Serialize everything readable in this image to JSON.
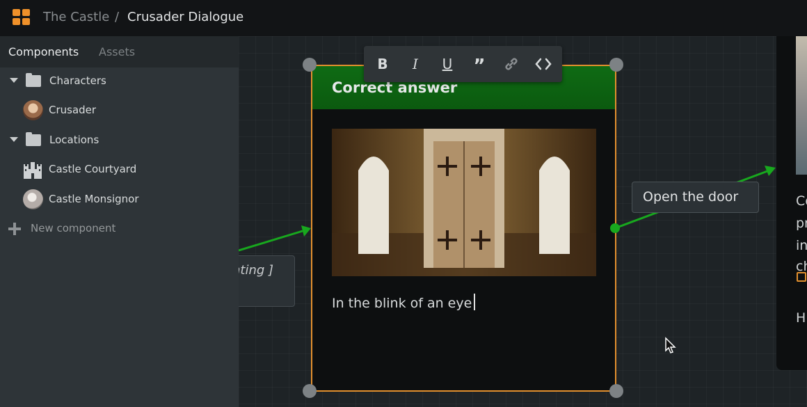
{
  "breadcrumb": {
    "project": "The Castle",
    "separator": "/",
    "current": "Crusader Dialogue"
  },
  "sidebar": {
    "tabs": [
      "Components",
      "Assets"
    ],
    "tree": [
      {
        "label": "Characters",
        "icon": "folder-icon"
      },
      {
        "label": "Crusader",
        "icon": "crusader-avatar"
      },
      {
        "label": "Locations",
        "icon": "folder-icon"
      },
      {
        "label": "Castle Courtyard",
        "icon": "castle-icon"
      },
      {
        "label": "Castle Monsignor",
        "icon": "monsignor-avatar"
      }
    ],
    "new_component": "New component"
  },
  "canvas": {
    "left_node_text": "nting ]",
    "node": {
      "title": "Correct answer",
      "text": "In the blink of an eye"
    },
    "toolbar": [
      "bold-icon",
      "italic-icon",
      "underline-icon",
      "quote-icon",
      "link-icon",
      "code-icon"
    ],
    "choice_label": "Open the door",
    "right_panel_fragments": [
      "Co",
      "pr",
      "in",
      "ch",
      "H"
    ]
  },
  "colors": {
    "accent": "#e3902e",
    "header_green": "#0f6b14",
    "connector": "#18a81e"
  }
}
